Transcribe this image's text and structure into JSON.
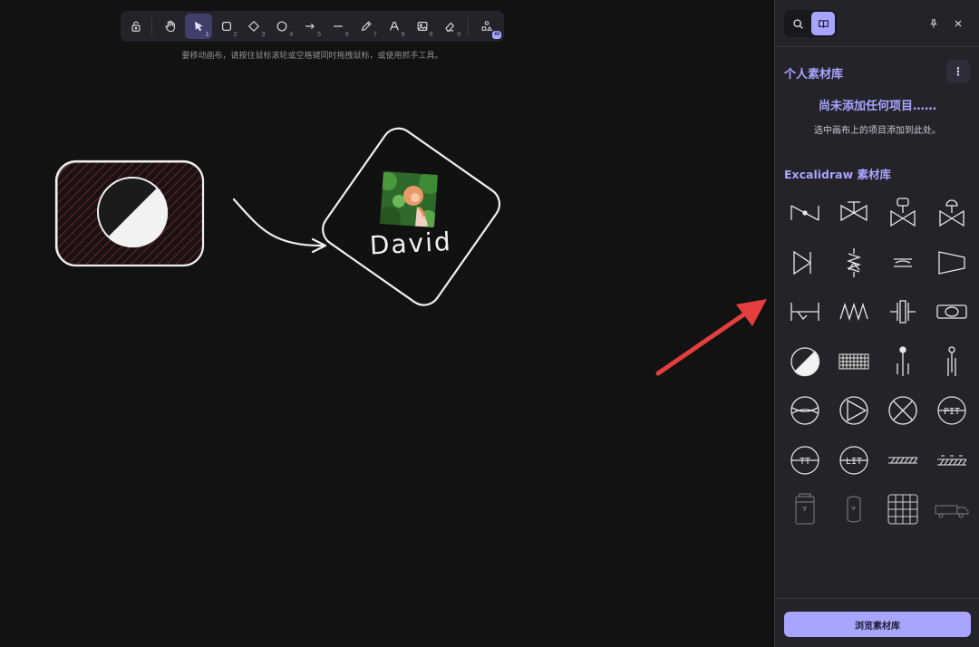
{
  "toolbar": {
    "tools": [
      {
        "name": "lock-icon",
        "key": ""
      },
      {
        "name": "hand-icon",
        "key": ""
      },
      {
        "name": "selection-icon",
        "key": "1"
      },
      {
        "name": "rectangle-icon",
        "key": "2"
      },
      {
        "name": "diamond-icon",
        "key": "3"
      },
      {
        "name": "ellipse-icon",
        "key": "4"
      },
      {
        "name": "arrow-icon",
        "key": "5"
      },
      {
        "name": "line-icon",
        "key": "6"
      },
      {
        "name": "pencil-icon",
        "key": "7"
      },
      {
        "name": "text-icon",
        "key": "8"
      },
      {
        "name": "image-icon",
        "key": "9"
      },
      {
        "name": "eraser-icon",
        "key": "0"
      },
      {
        "name": "shapes-more-icon",
        "key": ""
      }
    ],
    "ai_badge": "AI",
    "active_tool": "selection"
  },
  "hint": "要移动画布，请按住鼠标滚轮或空格键同时拖拽鼠标，或使用抓手工具。",
  "canvas": {
    "handwritten_text": "David",
    "background": "#121212"
  },
  "sidebar": {
    "tabs": [
      {
        "name": "search-icon",
        "active": false
      },
      {
        "name": "library-icon",
        "active": true
      }
    ],
    "pin_icon": "pin-icon",
    "close_icon": "close-icon",
    "personal": {
      "title": "个人素材库",
      "menu": "⋮",
      "empty_title": "尚未添加任何项目……",
      "empty_desc": "选中画布上的项目添加到此处。"
    },
    "excalidraw": {
      "title": "Excalidraw 素材库",
      "items": [
        "valve-item",
        "gate-valve-item",
        "actuated-valve-item",
        "control-valve-item",
        "check-valve-item",
        "relief-valve-item",
        "orifice-item",
        "reducer-item",
        "weir-item",
        "spring-item",
        "flange-item",
        "flow-meter-item",
        "ball-valve-item",
        "filter-item",
        "sensor-probe-item",
        "thermowell-item",
        "pump-item",
        "pump-play-item",
        "cross-circle-item",
        "pit-instrument-item",
        "tt-instrument-item",
        "lit-instrument-item",
        "pipe-hatched-item",
        "pipe-support-item",
        "tank-item",
        "vessel-item",
        "grid-item",
        "truck-item"
      ],
      "instrument_labels": [
        "PIT",
        "TT",
        "LIT"
      ]
    },
    "browse_button": "浏览素材库"
  },
  "colors": {
    "accent": "#a8a5ff",
    "panel": "#232329",
    "annotation_arrow": "#e53e3e"
  }
}
